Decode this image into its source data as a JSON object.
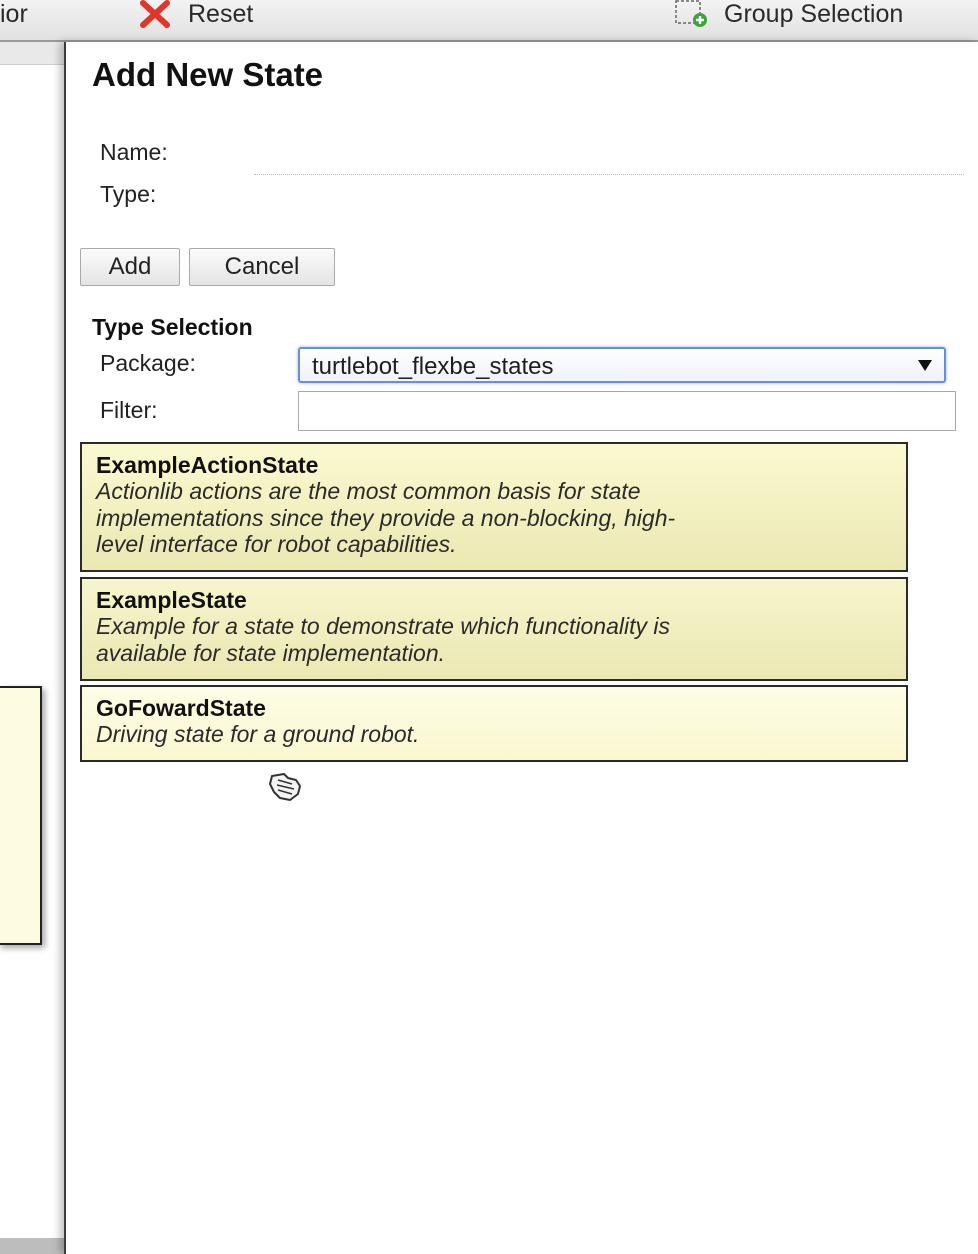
{
  "toolbar": {
    "behavior_label": "ior",
    "reset_label": "Reset",
    "group_selection_label": "Group Selection"
  },
  "panel": {
    "title": "Add New State",
    "name_label": "Name:",
    "name_value": "",
    "type_label": "Type:",
    "type_value": "",
    "add_button": "Add",
    "cancel_button": "Cancel",
    "type_selection_title": "Type Selection",
    "package_label": "Package:",
    "package_selected": "turtlebot_flexbe_states",
    "filter_label": "Filter:",
    "filter_value": ""
  },
  "states": [
    {
      "name": "ExampleActionState",
      "desc_lines": [
        "Actionlib actions are the most common basis for state",
        "implementations since they provide a non-blocking, high-",
        "level interface for robot capabilities."
      ]
    },
    {
      "name": "ExampleState",
      "desc_lines": [
        "Example for a state to demonstrate which functionality is",
        "available for state implementation."
      ]
    },
    {
      "name": "GoFowardState",
      "desc_lines": [
        "Driving state for a ground robot."
      ]
    }
  ],
  "icons": {
    "reset": "red-x-icon",
    "group_selection": "dashed-box-plus-icon",
    "reset_color": "#e0352b",
    "group_plus_color": "#3aa53a"
  }
}
